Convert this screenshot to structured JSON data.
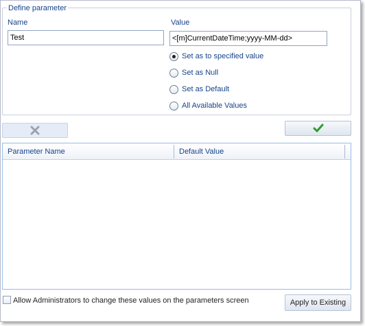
{
  "define": {
    "legend": "Define parameter",
    "name_label": "Name",
    "name_value": "Test",
    "value_label": "Value",
    "value_value": "<[m]CurrentDateTime;yyyy-MM-dd>",
    "options": [
      {
        "label": "Set as to specified value",
        "checked": true
      },
      {
        "label": "Set as Null",
        "checked": false
      },
      {
        "label": "Set as Default",
        "checked": false
      },
      {
        "label": "All Available Values",
        "checked": false
      }
    ]
  },
  "toolbar": {
    "delete_icon": "x-icon",
    "confirm_icon": "checkmark-icon",
    "confirm_color": "#2e9a2e"
  },
  "grid": {
    "columns": [
      "Parameter Name",
      "Default Value"
    ],
    "rows": []
  },
  "footer": {
    "allow_admin_label": "Allow Administrators to change these values on the parameters screen",
    "allow_admin_checked": false,
    "apply_label": "Apply to Existing"
  }
}
